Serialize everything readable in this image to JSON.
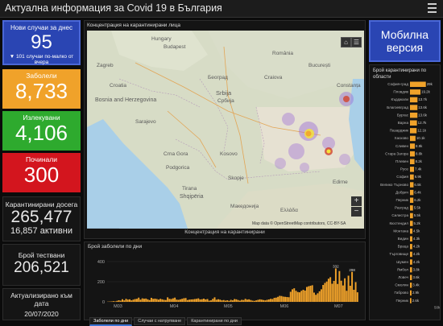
{
  "header": {
    "title": "Актуална информация за Covid 19 в България"
  },
  "cards": {
    "new": {
      "label": "Нови случаи за днес",
      "value": "95",
      "sub": "▼ 101 случаи по-малко от вчера"
    },
    "sick": {
      "label": "Заболели",
      "value": "8,733"
    },
    "recovered": {
      "label": "Излекувани",
      "value": "4,106"
    },
    "dead": {
      "label": "Починали",
      "value": "300"
    },
    "quarantined": {
      "label": "Карантинирани досега",
      "value": "265,477",
      "sub": "16,857 активни"
    },
    "tests": {
      "label": "Брой тествани",
      "value": "206,521"
    },
    "updated": {
      "label": "Актуализирано към дата",
      "value": "20/07/2020"
    }
  },
  "map": {
    "header": "Концентрация на карантинирани лица",
    "footer": "Концентрация на карантинирани",
    "attribution": "Map data © OpenStreetMap contributors, CC-BY-SA",
    "places": [
      "Budapest",
      "Hungary",
      "Croatia",
      "Zagreb",
      "Bosnia and Herzegovina",
      "Sarajevo",
      "Srbija",
      "Србија",
      "Београд",
      "București",
      "Crna Gora",
      "Podgorica",
      "Kosovo",
      "Skopje",
      "Shqipëria",
      "Tirana",
      "Македонија",
      "Ελλάδα",
      "România",
      "Craiova",
      "Constanța",
      "Edirne"
    ]
  },
  "mobile": {
    "label": "Мобилна версия"
  },
  "regions": {
    "header": "Брой карантинирани по области",
    "items": [
      {
        "name": "София-град",
        "label": "29k",
        "value": 29
      },
      {
        "name": "Пловдив",
        "label": "19.2k",
        "value": 19.2
      },
      {
        "name": "Кърджали",
        "label": "13.7k",
        "value": 13.7
      },
      {
        "name": "Благоевград",
        "label": "13.6k",
        "value": 13.6
      },
      {
        "name": "Бургас",
        "label": "13.6k",
        "value": 13.6
      },
      {
        "name": "Варна",
        "label": "12.7k",
        "value": 12.7
      },
      {
        "name": "Пазарджик",
        "label": "12.1k",
        "value": 12.1
      },
      {
        "name": "Хасково",
        "label": "10.1k",
        "value": 10.1
      },
      {
        "name": "Сливен",
        "label": "8.9k",
        "value": 8.9
      },
      {
        "name": "Стара Загора",
        "label": "8.8k",
        "value": 8.8
      },
      {
        "name": "Плевен",
        "label": "8.2k",
        "value": 8.2
      },
      {
        "name": "Русе",
        "label": "7.4k",
        "value": 7.4
      },
      {
        "name": "София",
        "label": "6.9k",
        "value": 6.9
      },
      {
        "name": "Велико Търново",
        "label": "6.5k",
        "value": 6.5
      },
      {
        "name": "Добрич",
        "label": "6.4k",
        "value": 6.4
      },
      {
        "name": "Перник",
        "label": "6.2k",
        "value": 6.2
      },
      {
        "name": "Разград",
        "label": "5.5k",
        "value": 5.5
      },
      {
        "name": "Силистра",
        "label": "5.5k",
        "value": 5.5
      },
      {
        "name": "Кюстендил",
        "label": "5.2k",
        "value": 5.2
      },
      {
        "name": "Монтана",
        "label": "4.5k",
        "value": 4.5
      },
      {
        "name": "Видин",
        "label": "4.3k",
        "value": 4.3
      },
      {
        "name": "Враца",
        "label": "4.2k",
        "value": 4.2
      },
      {
        "name": "Търговище",
        "label": "4.2k",
        "value": 4.2
      },
      {
        "name": "Шумен",
        "label": "4.2k",
        "value": 4.2
      },
      {
        "name": "Ямбол",
        "label": "3.8k",
        "value": 3.8
      },
      {
        "name": "Ловеч",
        "label": "3.6k",
        "value": 3.6
      },
      {
        "name": "Смолян",
        "label": "3.4k",
        "value": 3.4
      },
      {
        "name": "Габрово",
        "label": "2.9k",
        "value": 2.9
      },
      {
        "name": "Перник",
        "label": "2.6k",
        "value": 2.6
      }
    ],
    "axis_label": "50k"
  },
  "chart": {
    "header": "Брой заболели по дни",
    "tabs": [
      "Заболели по дни",
      "Случаи с натрупване",
      "Карантинирани по дни"
    ]
  },
  "chart_data": {
    "type": "bar",
    "ylim": [
      0,
      400
    ],
    "yticks": [
      0,
      200,
      400
    ],
    "xticks": [
      "М03",
      "М04",
      "М05",
      "М06",
      "М07"
    ],
    "values": [
      2,
      3,
      4,
      7,
      4,
      10,
      16,
      12,
      26,
      15,
      30,
      22,
      25,
      15,
      22,
      28,
      30,
      42,
      22,
      35,
      31,
      33,
      25,
      18,
      40,
      30,
      32,
      28,
      22,
      30,
      25,
      20,
      18,
      45,
      30,
      28,
      35,
      42,
      22,
      20,
      25,
      30,
      36,
      38,
      18,
      22,
      24,
      25,
      28,
      30,
      35,
      24,
      26,
      32,
      24,
      28,
      12,
      15,
      30,
      45,
      21,
      26,
      22,
      15,
      18,
      12,
      16,
      10,
      20,
      15,
      28,
      25,
      18,
      12,
      20,
      18,
      30,
      22,
      25,
      18,
      12,
      10,
      15,
      20,
      25,
      22,
      18,
      15,
      20,
      24,
      30,
      28,
      40,
      42,
      50,
      60,
      58,
      52,
      50,
      48,
      46,
      100,
      125,
      135,
      110,
      98,
      95,
      110,
      120,
      112,
      148,
      155,
      160,
      165,
      92,
      70,
      85,
      105,
      125,
      168,
      188,
      202,
      230,
      245,
      180,
      208,
      332,
      178,
      306,
      210,
      163,
      234,
      110,
      260,
      160,
      298,
      120,
      196,
      95
    ],
    "labels": [
      {
        "index": 126,
        "text": "332"
      },
      {
        "index": 135,
        "text": "298"
      }
    ]
  }
}
